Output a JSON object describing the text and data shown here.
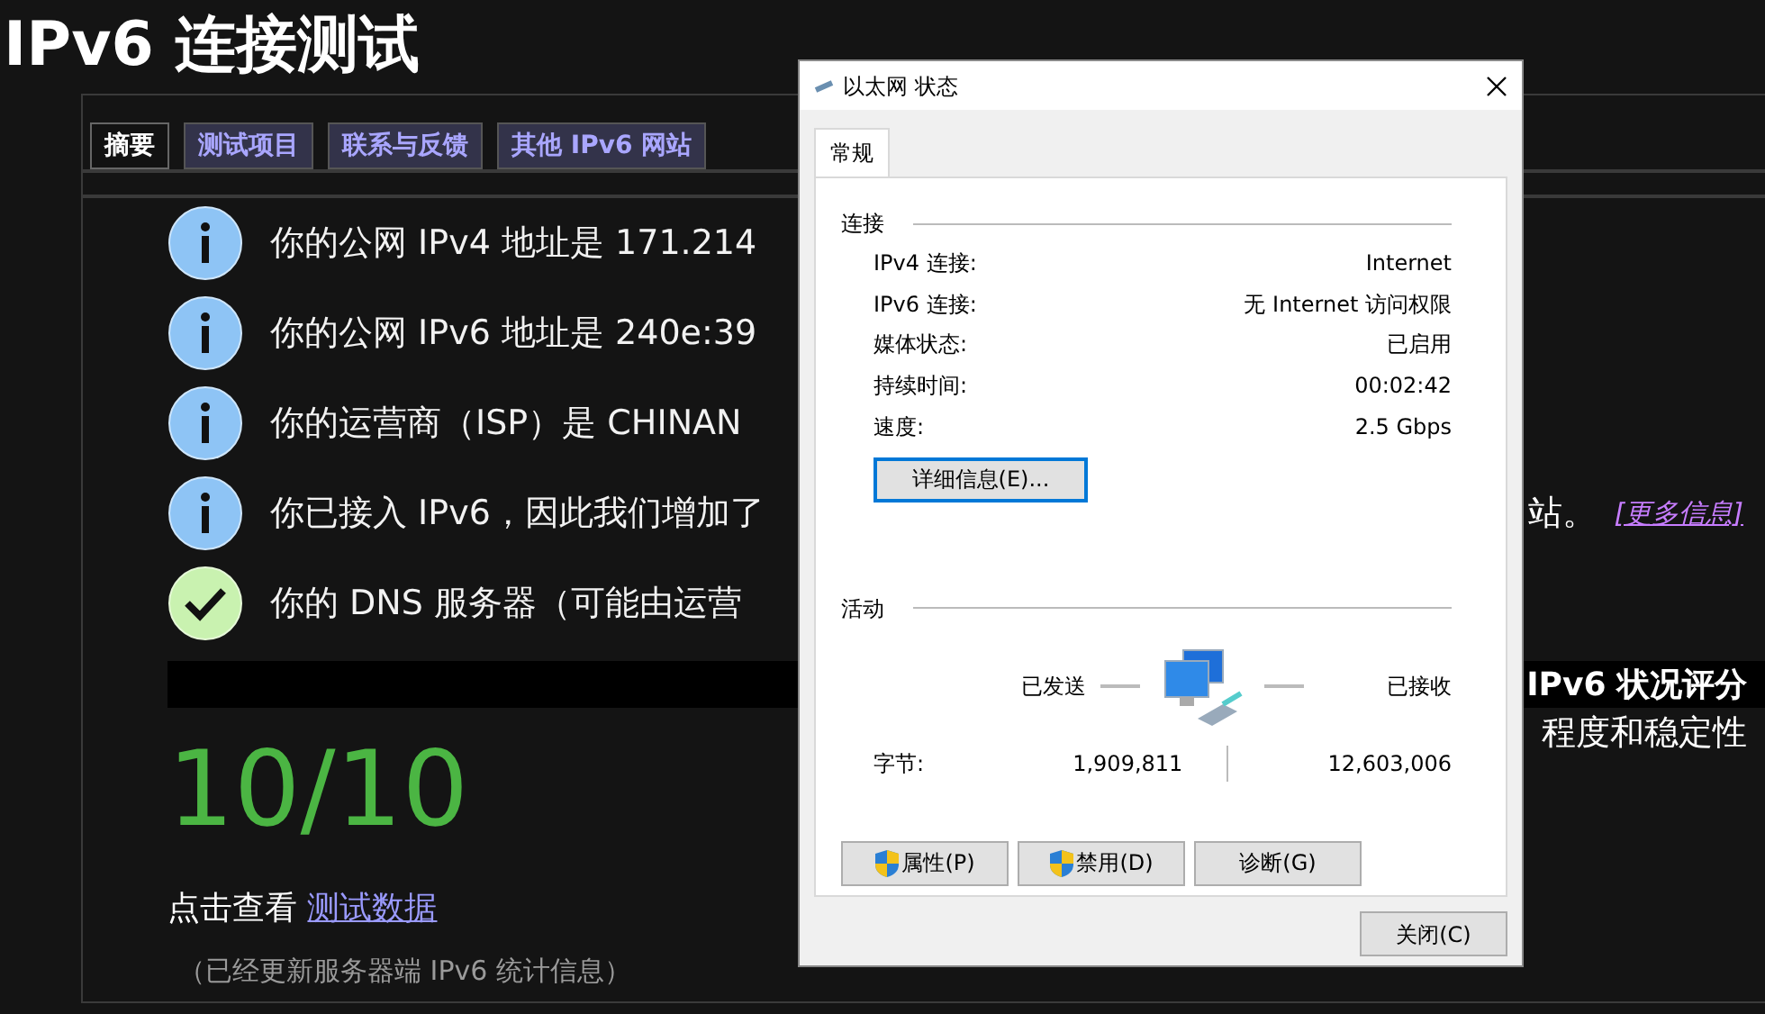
{
  "page": {
    "title": "IPv6 连接测试",
    "tabs": [
      {
        "label": "摘要",
        "selected": true
      },
      {
        "label": "测试项目",
        "selected": false
      },
      {
        "label": "联系与反馈",
        "selected": false
      },
      {
        "label": "其他 IPv6 网站",
        "selected": false
      }
    ],
    "results": [
      {
        "kind": "info",
        "text": "你的公网 IPv4 地址是 171.214"
      },
      {
        "kind": "info",
        "text": "你的公网 IPv6 地址是 240e:39"
      },
      {
        "kind": "info",
        "text": "你的运营商（ISP）是 CHINAN"
      },
      {
        "kind": "info",
        "text": "你已接入 IPv6，因此我们增加了",
        "tail": "站。",
        "tail_link": "[更多信息]"
      },
      {
        "kind": "ok",
        "text": "你的 DNS 服务器（可能由运营"
      }
    ],
    "score_heading": "IPv6 状况评分",
    "score_caption": "程度和稳定性",
    "score": "10/10",
    "view_text": "点击查看",
    "view_link": "测试数据",
    "note": "（已经更新服务器端 IPv6 统计信息）"
  },
  "dialog": {
    "title": "以太网 状态",
    "tabs": [
      {
        "label": "常规",
        "selected": true
      }
    ],
    "connection": {
      "heading": "连接",
      "rows": [
        {
          "label": "IPv4 连接:",
          "value": "Internet"
        },
        {
          "label": "IPv6 连接:",
          "value": "无 Internet 访问权限"
        },
        {
          "label": "媒体状态:",
          "value": "已启用"
        },
        {
          "label": "持续时间:",
          "value": "00:02:42"
        },
        {
          "label": "速度:",
          "value": "2.5 Gbps"
        }
      ],
      "details_button": {
        "label": "详细信息(E)...",
        "focused": true
      }
    },
    "activity": {
      "heading": "活动",
      "sent_label": "已发送",
      "received_label": "已接收",
      "bytes_label": "字节:",
      "sent": "1,909,811",
      "received": "12,603,006"
    },
    "buttons": [
      {
        "label": "属性(P)",
        "shield": true
      },
      {
        "label": "禁用(D)",
        "shield": true
      },
      {
        "label": "诊断(G)",
        "shield": false
      }
    ],
    "close_button": "关闭(C)"
  }
}
